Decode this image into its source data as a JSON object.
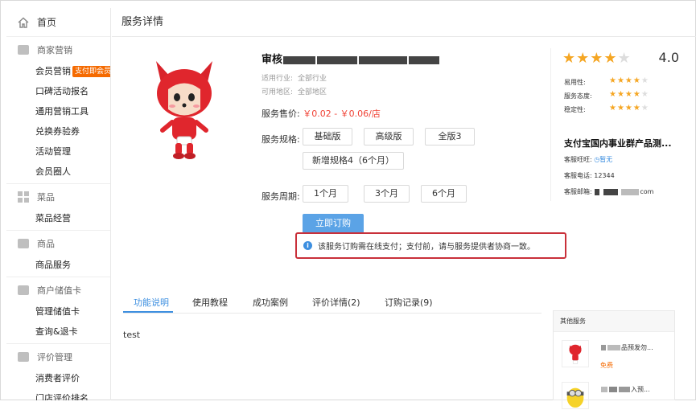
{
  "sidebar": {
    "home": "首页",
    "sections": [
      {
        "title": "商家营销",
        "items": [
          "会员营销",
          "口碑活动报名",
          "通用营销工具",
          "兑换券验券",
          "活动管理",
          "会员圈人"
        ],
        "badge": "支付即会员"
      },
      {
        "title": "菜品",
        "items": [
          "菜品经营"
        ]
      },
      {
        "title": "商品",
        "items": [
          "商品服务"
        ]
      },
      {
        "title": "商户储值卡",
        "items": [
          "管理储值卡",
          "查询&退卡"
        ]
      },
      {
        "title": "评价管理",
        "items": [
          "消费者评价",
          "门店评价排名"
        ]
      }
    ]
  },
  "page": {
    "title": "服务详情",
    "product_name_prefix": "审核",
    "industry_label": "适用行业:",
    "industry_value": "全部行业",
    "region_label": "可用地区:",
    "region_value": "全部地区",
    "price_label": "服务售价:",
    "price_value": "￥0.02 - ￥0.06/店",
    "spec_label": "服务规格:",
    "specs": [
      "基础版",
      "高级版",
      "全版3",
      "新增规格4（6个月）"
    ],
    "period_label": "服务周期:",
    "periods": [
      "1个月",
      "3个月",
      "6个月"
    ],
    "buy_label": "立即订购",
    "notice": "该服务订购需在线支付；支付前，请与服务提供者协商一致。"
  },
  "rating": {
    "overall": "4.0",
    "overall_stars": 4,
    "subs": [
      {
        "label": "易用性:",
        "stars": 4
      },
      {
        "label": "服务态度:",
        "stars": 4
      },
      {
        "label": "稳定性:",
        "stars": 4
      }
    ]
  },
  "provider": {
    "name": "支付宝国内事业群产品测...",
    "wangwang_label": "客服旺旺:",
    "wangwang_value": "暂无",
    "phone_label": "客服电话:",
    "phone_value": "12344",
    "email_label": "客服邮箱:",
    "email_suffix": "com"
  },
  "tabs": [
    "功能说明",
    "使用教程",
    "成功案例",
    "评价详情(2)",
    "订购记录(9)"
  ],
  "active_tab": "功能说明",
  "content": "test",
  "other_services": {
    "title": "其他服务",
    "items": [
      {
        "name_suffix": "品预发勿...",
        "price": "免费"
      },
      {
        "name_suffix": "入预..."
      }
    ]
  },
  "colors": {
    "accent": "#3d8fe0",
    "price": "#f04134",
    "star": "#f5a623",
    "badge": "#f56a00",
    "highlight_border": "#c9303a"
  }
}
